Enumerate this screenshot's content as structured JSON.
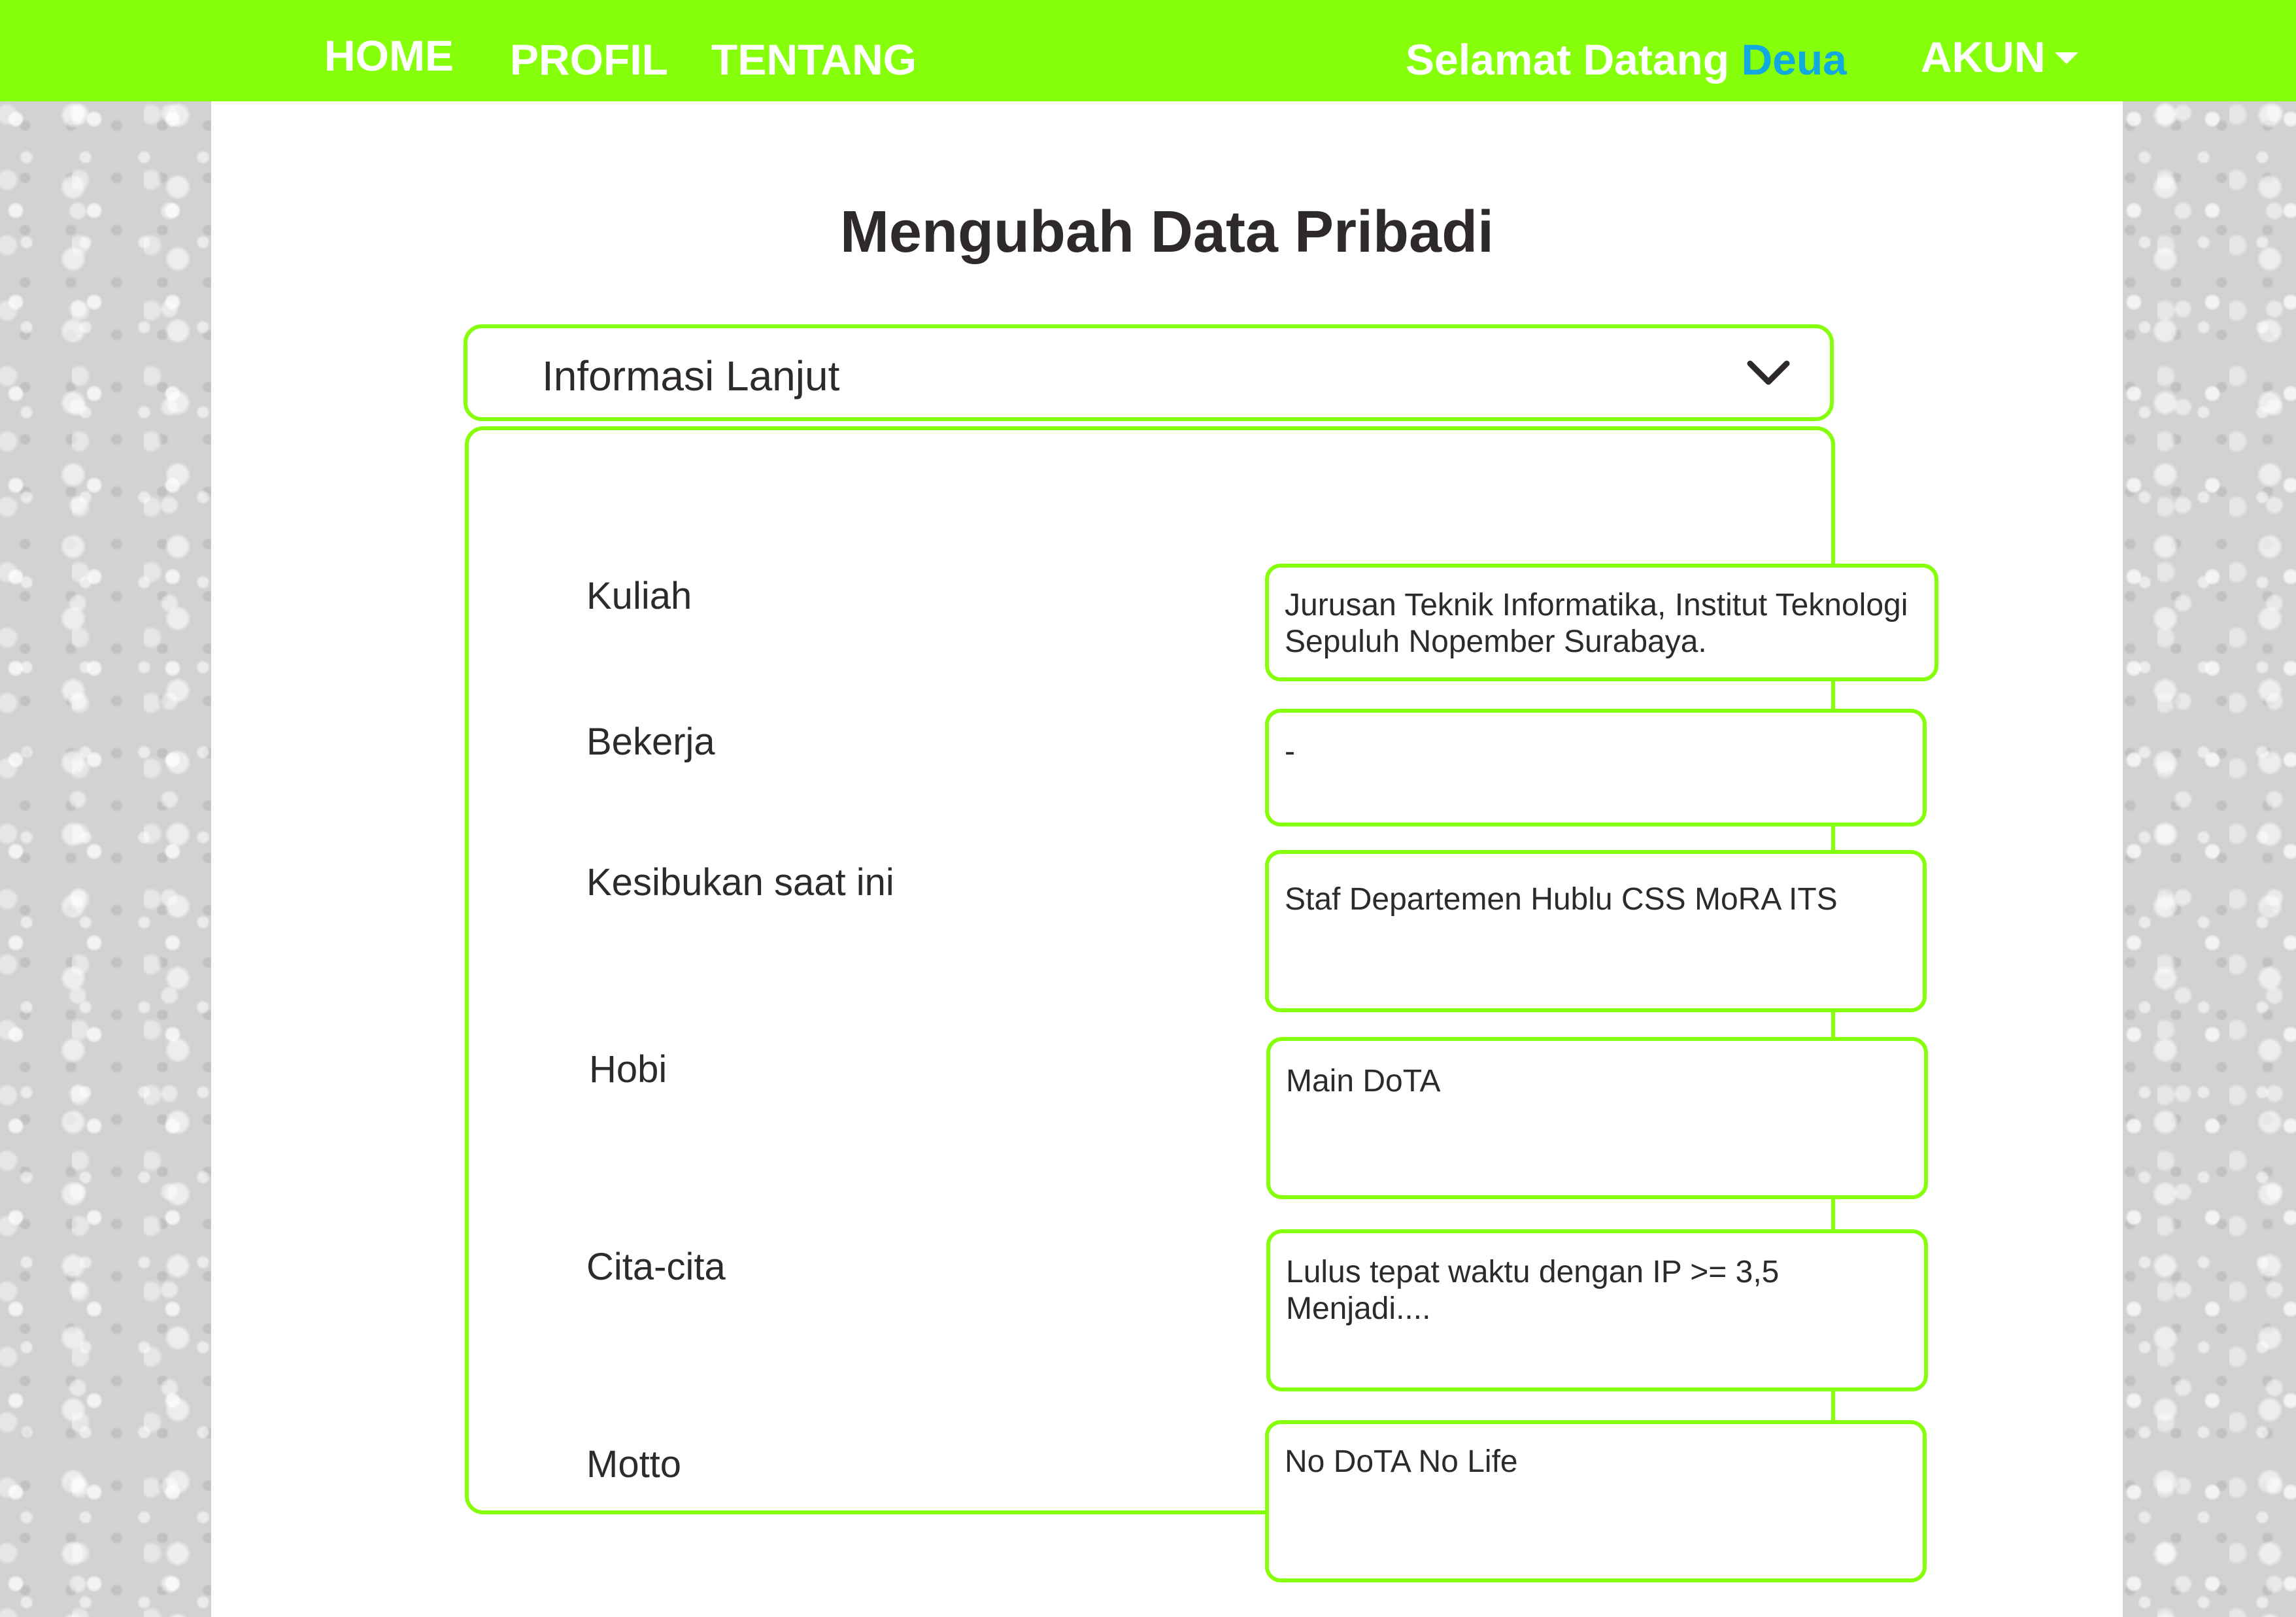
{
  "nav": {
    "home": "HOME",
    "profil": "PROFIL",
    "tentang": "TENTANG",
    "greeting_prefix": "Selamat Datang ",
    "username": "Deua",
    "account": "AKUN"
  },
  "page": {
    "title": "Mengubah Data Pribadi"
  },
  "section": {
    "title": "Informasi Lanjut"
  },
  "fields": [
    {
      "label": "Kuliah",
      "value": "Jurusan Teknik Informatika, Institut Teknologi\nSepuluh Nopember Surabaya."
    },
    {
      "label": "Bekerja",
      "value": "-"
    },
    {
      "label": "Kesibukan saat ini",
      "value": "Staf Departemen Hublu CSS MoRA ITS"
    },
    {
      "label": "Hobi",
      "value": "Main DoTA"
    },
    {
      "label": "Cita-cita",
      "value": "Lulus tepat waktu dengan IP >= 3,5\nMenjadi...."
    },
    {
      "label": "Motto",
      "value": "No DoTA No Life"
    }
  ],
  "colors": {
    "accent_green": "#86ff0a",
    "username_blue": "#12a8e0",
    "text_dark": "#2f2a2a"
  },
  "icons": {
    "account_caret": "caret-down-icon",
    "section_toggle": "chevron-down-icon"
  }
}
